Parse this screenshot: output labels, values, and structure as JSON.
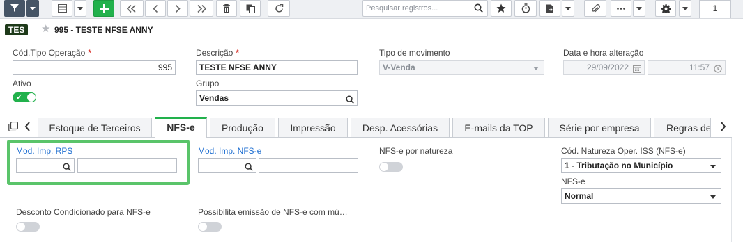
{
  "toolbar": {
    "buttons": [
      {
        "name": "filter-icon"
      },
      {
        "name": "grid-icon"
      },
      {
        "name": "plus-icon"
      },
      {
        "name": "first-icon"
      },
      {
        "name": "prev-icon"
      },
      {
        "name": "next-icon"
      },
      {
        "name": "last-icon"
      },
      {
        "name": "trash-icon"
      },
      {
        "name": "copy-icon"
      },
      {
        "name": "refresh-icon"
      },
      {
        "name": "star-icon"
      },
      {
        "name": "timer-icon"
      },
      {
        "name": "export-icon"
      },
      {
        "name": "attach-icon"
      },
      {
        "name": "more-icon"
      },
      {
        "name": "gear-icon"
      }
    ],
    "search_placeholder": "Pesquisar registros...",
    "page_number": "1"
  },
  "header": {
    "badge": "TES",
    "title": "995 - TESTE NFSE ANNY"
  },
  "form": {
    "cod_tipo_label": "Cód.Tipo Operação",
    "cod_tipo_value": "995",
    "descricao_label": "Descrição",
    "descricao_value": "TESTE NFSE ANNY",
    "tipo_mov_label": "Tipo de movimento",
    "tipo_mov_value": "V-Venda",
    "data_label": "Data e hora alteração",
    "data_value": "29/09/2022",
    "hora_value": "11:57",
    "ativo_label": "Ativo",
    "ativo_checked": true,
    "grupo_label": "Grupo",
    "grupo_value": "Vendas",
    "required_mark": "*"
  },
  "tabs": [
    {
      "label": "Estoque de Terceiros",
      "active": false
    },
    {
      "label": "NFS-e",
      "active": true
    },
    {
      "label": "Produção",
      "active": false
    },
    {
      "label": "Impressão",
      "active": false
    },
    {
      "label": "Desp. Acessórias",
      "active": false
    },
    {
      "label": "E-mails da TOP",
      "active": false
    },
    {
      "label": "Série por empresa",
      "active": false
    },
    {
      "label": "Regras de",
      "active": false
    }
  ],
  "nfse": {
    "mod_rps_label": "Mod. Imp. RPS",
    "mod_rps_code": "",
    "mod_rps_desc": "",
    "mod_nfse_label": "Mod. Imp. NFS-e",
    "mod_nfse_code": "",
    "mod_nfse_desc": "",
    "por_natureza_label": "NFS-e por natureza",
    "por_natureza_on": false,
    "cod_natureza_label": "Cód. Natureza Oper. ISS (NFS-e)",
    "cod_natureza_value": "1 - Tributação no Município",
    "nfse_label": "NFS-e",
    "nfse_value": "Normal",
    "desconto_label": "Desconto Condicionado para NFS-e",
    "desconto_on": false,
    "possibilita_label": "Possibilita emissão de NFS-e com mú…",
    "possibilita_on": false
  },
  "colors": {
    "accent": "#22b14c",
    "highlight": "#5ac46a",
    "required": "#d9322b",
    "link_label": "#1f6fd1"
  }
}
